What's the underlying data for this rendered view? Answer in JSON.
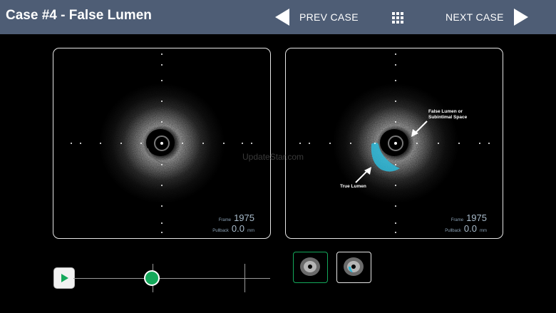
{
  "header": {
    "title": "Case #4 - False Lumen",
    "prev_label": "PREV CASE",
    "next_label": "NEXT CASE"
  },
  "left_panel": {
    "frame_label": "Frame",
    "frame_value": "1975",
    "pullback_label": "Pullback",
    "pullback_value": "0.0",
    "pullback_unit": "mm"
  },
  "right_panel": {
    "annotation_false_lumen_line1": "False Lumen or",
    "annotation_false_lumen_line2": "Subintimal Space",
    "annotation_true_lumen": "True Lumen",
    "frame_label": "Frame",
    "frame_value": "1975",
    "pullback_label": "Pullback",
    "pullback_value": "0.0",
    "pullback_unit": "mm"
  },
  "watermark": "UpdateStar.com",
  "playback": {
    "progress_fraction": 0.4
  },
  "colors": {
    "header_bg": "#4e5d75",
    "accent_green": "#14a85a",
    "false_lumen_highlight": "#2bb8d8"
  },
  "icons": {
    "prev": "triangle-left-icon",
    "next": "triangle-right-icon",
    "grid": "grid-icon",
    "play": "play-icon"
  }
}
